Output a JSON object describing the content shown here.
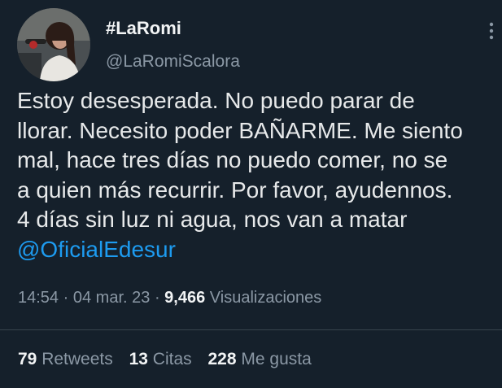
{
  "user": {
    "display_name": "#LaRomi",
    "handle": "@LaRomiScalora"
  },
  "tweet": {
    "lines": [
      "Estoy desesperada. No puedo parar de",
      "llorar. Necesito poder BAÑARME. Me siento",
      "mal, hace tres días no puedo comer, no se",
      "a quien más recurrir. Por favor, ayudennos.",
      "4 días sin luz ni agua, nos van a matar"
    ],
    "mention": "@OficialEdesur"
  },
  "meta": {
    "time": "14:54",
    "sep1": "·",
    "date": "04 mar. 23",
    "sep2": "·",
    "views": "9,466",
    "views_label": "Visualizaciones"
  },
  "stats": {
    "retweets_count": "79",
    "retweets_label": "Retweets",
    "quotes_count": "13",
    "quotes_label": "Citas",
    "likes_count": "228",
    "likes_label": "Me gusta"
  },
  "icons": {
    "more": "more-vertical-icon"
  },
  "colors": {
    "background": "#15202b",
    "text": "#e7e9ea",
    "secondary": "#8b98a5",
    "link": "#1d9bf0",
    "divider": "#38444d"
  }
}
